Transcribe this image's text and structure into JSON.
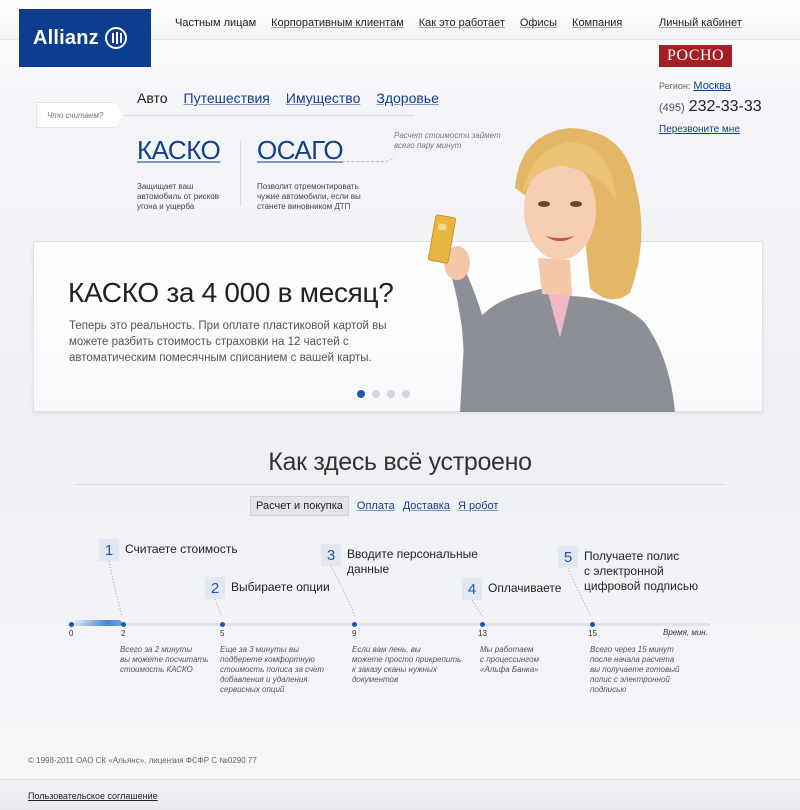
{
  "brand": {
    "name": "Allianz",
    "partner": "РОСНО"
  },
  "topnav": {
    "items": [
      "Частным лицам",
      "Корпоративным клиентам",
      "Как это работает",
      "Офисы",
      "Компания"
    ],
    "cabinet": "Личный кабинет"
  },
  "contact": {
    "region_label": "Регион:",
    "city": "Москва",
    "phone_code": "(495)",
    "phone": "232-33-33",
    "callback": "Перезвоните мне"
  },
  "calc": {
    "prompt": "Что считаем?",
    "tabs": [
      "Авто",
      "Путешествия",
      "Имущество",
      "Здоровье"
    ],
    "products": [
      {
        "title": "КАСКО",
        "desc": [
          "Защищает ваш",
          "автомобиль от рисков",
          "угона и ущерба"
        ]
      },
      {
        "title": "ОСАГО",
        "desc": [
          "Позволит отремонтировать",
          "чужие автомобили, если вы",
          "станете виновником ДТП"
        ]
      }
    ],
    "note": [
      "Расчет стоимости займет",
      "всего пару минут"
    ]
  },
  "banner": {
    "title": "КАСКО за 4 000 в месяц?",
    "text": "Теперь это реальность. При оплате пластиковой картой вы можете разбить стоимость страховки на 12 частей с автоматическим помесячным списанием с вашей карты.",
    "slides": 4,
    "active_slide": 1
  },
  "how": {
    "title": "Как здесь всё устроено",
    "tabs": [
      "Расчет и покупка",
      "Оплата",
      "Доставка",
      "Я робот"
    ],
    "steps": [
      {
        "num": "1",
        "label": [
          "Считаете стоимость"
        ],
        "desc": [
          "Всего за 2 минуты",
          "вы можете посчитать",
          "стоимость КАСКО"
        ]
      },
      {
        "num": "2",
        "label": [
          "Выбираете опции"
        ],
        "desc": [
          "Еще за 3 минуты вы",
          "подберете комфортную",
          "стоимость полиса за счет",
          "добавления и удаления",
          "сервисных опций"
        ]
      },
      {
        "num": "3",
        "label": [
          "Вводите персональные",
          "данные"
        ],
        "desc": [
          "Если вам лень, вы",
          "можете просто прикрепить",
          "к заказу сканы нужных",
          "документов"
        ]
      },
      {
        "num": "4",
        "label": [
          "Оплачиваете"
        ],
        "desc": [
          "Мы работаем",
          "с процессингом",
          "«Альфа Банка»"
        ]
      },
      {
        "num": "5",
        "label": [
          "Получаете  полис",
          "с электронной",
          "цифровой подписью"
        ],
        "desc": [
          "Всего через 15 минут",
          "после начала расчета",
          "вы получаете готовый",
          "полис с электронной",
          "подписью"
        ]
      }
    ],
    "timeline_ticks": [
      "0",
      "2",
      "5",
      "9",
      "13",
      "15"
    ],
    "axis_label": "Время, мин."
  },
  "footer": {
    "copyright": "© 1998-2011 ОАО СК «Альянс», лицензия ФСФР С №0290 77",
    "agreement": "Пользовательское соглашение"
  },
  "colors": {
    "brand_blue": "#0d3d8f",
    "link": "#123f8c",
    "rosno_red": "#a51d26",
    "accent": "#1b56b8"
  }
}
